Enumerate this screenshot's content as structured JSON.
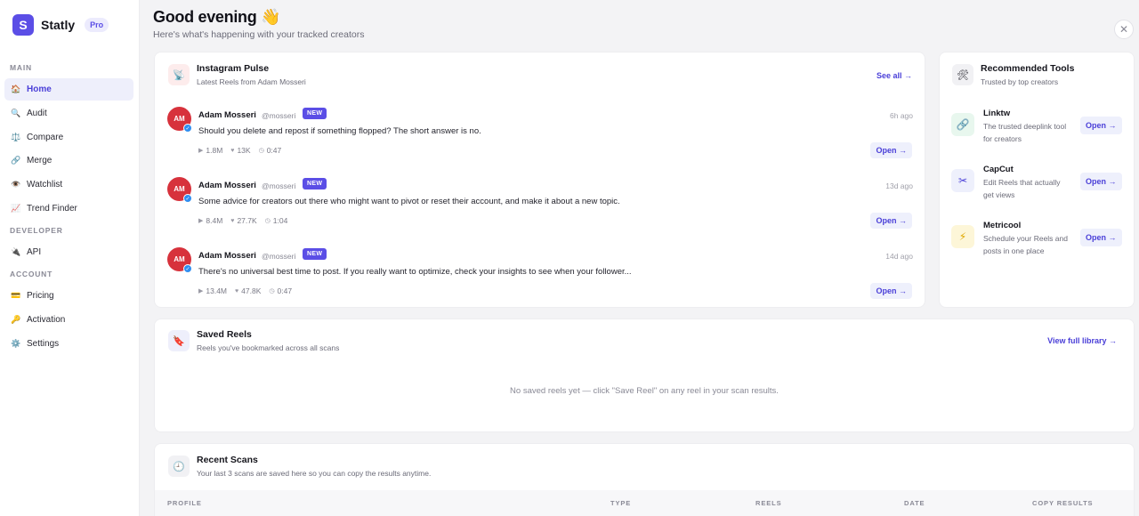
{
  "sidebar": {
    "brand": {
      "logo_letter": "S",
      "name": "Statly",
      "badge": "Pro"
    },
    "sections": [
      {
        "label": "MAIN",
        "items": [
          {
            "label": "Home",
            "icon": "🏠",
            "active": true
          },
          {
            "label": "Audit",
            "icon": "🔍"
          },
          {
            "label": "Compare",
            "icon": "⚖️"
          },
          {
            "label": "Merge",
            "icon": "🔗"
          },
          {
            "label": "Watchlist",
            "icon": "👁️"
          },
          {
            "label": "Trend Finder",
            "icon": "📈"
          }
        ]
      },
      {
        "label": "DEVELOPER",
        "items": [
          {
            "label": "API",
            "icon": "🔌"
          }
        ]
      },
      {
        "label": "ACCOUNT",
        "items": [
          {
            "label": "Pricing",
            "icon": "💳"
          },
          {
            "label": "Activation",
            "icon": "🔑"
          },
          {
            "label": "Settings",
            "icon": "⚙️"
          }
        ]
      }
    ]
  },
  "header": {
    "greeting": "Good evening 👋",
    "subtitle": "Here's what's happening with your tracked creators",
    "close_symbol": "✕"
  },
  "pulse": {
    "icon": "📡",
    "title": "Instagram Pulse",
    "subtitle": "Latest Reels from Adam Mosseri",
    "link": "See all →",
    "posts": [
      {
        "initials": "AM",
        "author": "Adam Mosseri",
        "handle": "@mosseri",
        "badge": "NEW",
        "time": "6h ago",
        "text": "Should you delete and repost if something flopped? The short answer is no.",
        "plays": "1.8M",
        "likes": "13K",
        "duration": "0:47",
        "open": "Open →"
      },
      {
        "initials": "AM",
        "author": "Adam Mosseri",
        "handle": "@mosseri",
        "badge": "NEW",
        "time": "13d ago",
        "text": "Some advice for creators out there who might want to pivot or reset their account, and make it about a new topic.",
        "plays": "8.4M",
        "likes": "27.7K",
        "duration": "1:04",
        "open": "Open →"
      },
      {
        "initials": "AM",
        "author": "Adam Mosseri",
        "handle": "@mosseri",
        "badge": "NEW",
        "time": "14d ago",
        "text": "There's no universal best time to post. If you really want to optimize, check your insights to see when your follower...",
        "plays": "13.4M",
        "likes": "47.8K",
        "duration": "0:47",
        "open": "Open →"
      }
    ]
  },
  "tools": {
    "icon": "🛠",
    "title": "Recommended Tools",
    "subtitle": "Trusted by top creators",
    "items": [
      {
        "name": "Linktw",
        "desc": "The trusted deeplink tool for creators",
        "icon": "🔗",
        "open": "Open →"
      },
      {
        "name": "CapCut",
        "desc": "Edit Reels that actually get views",
        "icon": "✂",
        "open": "Open →"
      },
      {
        "name": "Metricool",
        "desc": "Schedule your Reels and posts in one place",
        "icon": "⚡",
        "open": "Open →"
      }
    ]
  },
  "saved": {
    "icon": "🔖",
    "title": "Saved Reels",
    "subtitle": "Reels you've bookmarked across all scans",
    "link": "View full library →",
    "empty": "No saved reels yet — click \"Save Reel\" on any reel in your scan results."
  },
  "recent": {
    "icon": "🕘",
    "title": "Recent Scans",
    "subtitle": "Your last 3 scans are saved here so you can copy the results anytime.",
    "columns": [
      "PROFILE",
      "TYPE",
      "REELS",
      "DATE",
      "COPY RESULTS"
    ]
  },
  "colors": {
    "accent": "#5b4ee6",
    "avatar": "#d7323c",
    "verify": "#2f8ef0"
  }
}
